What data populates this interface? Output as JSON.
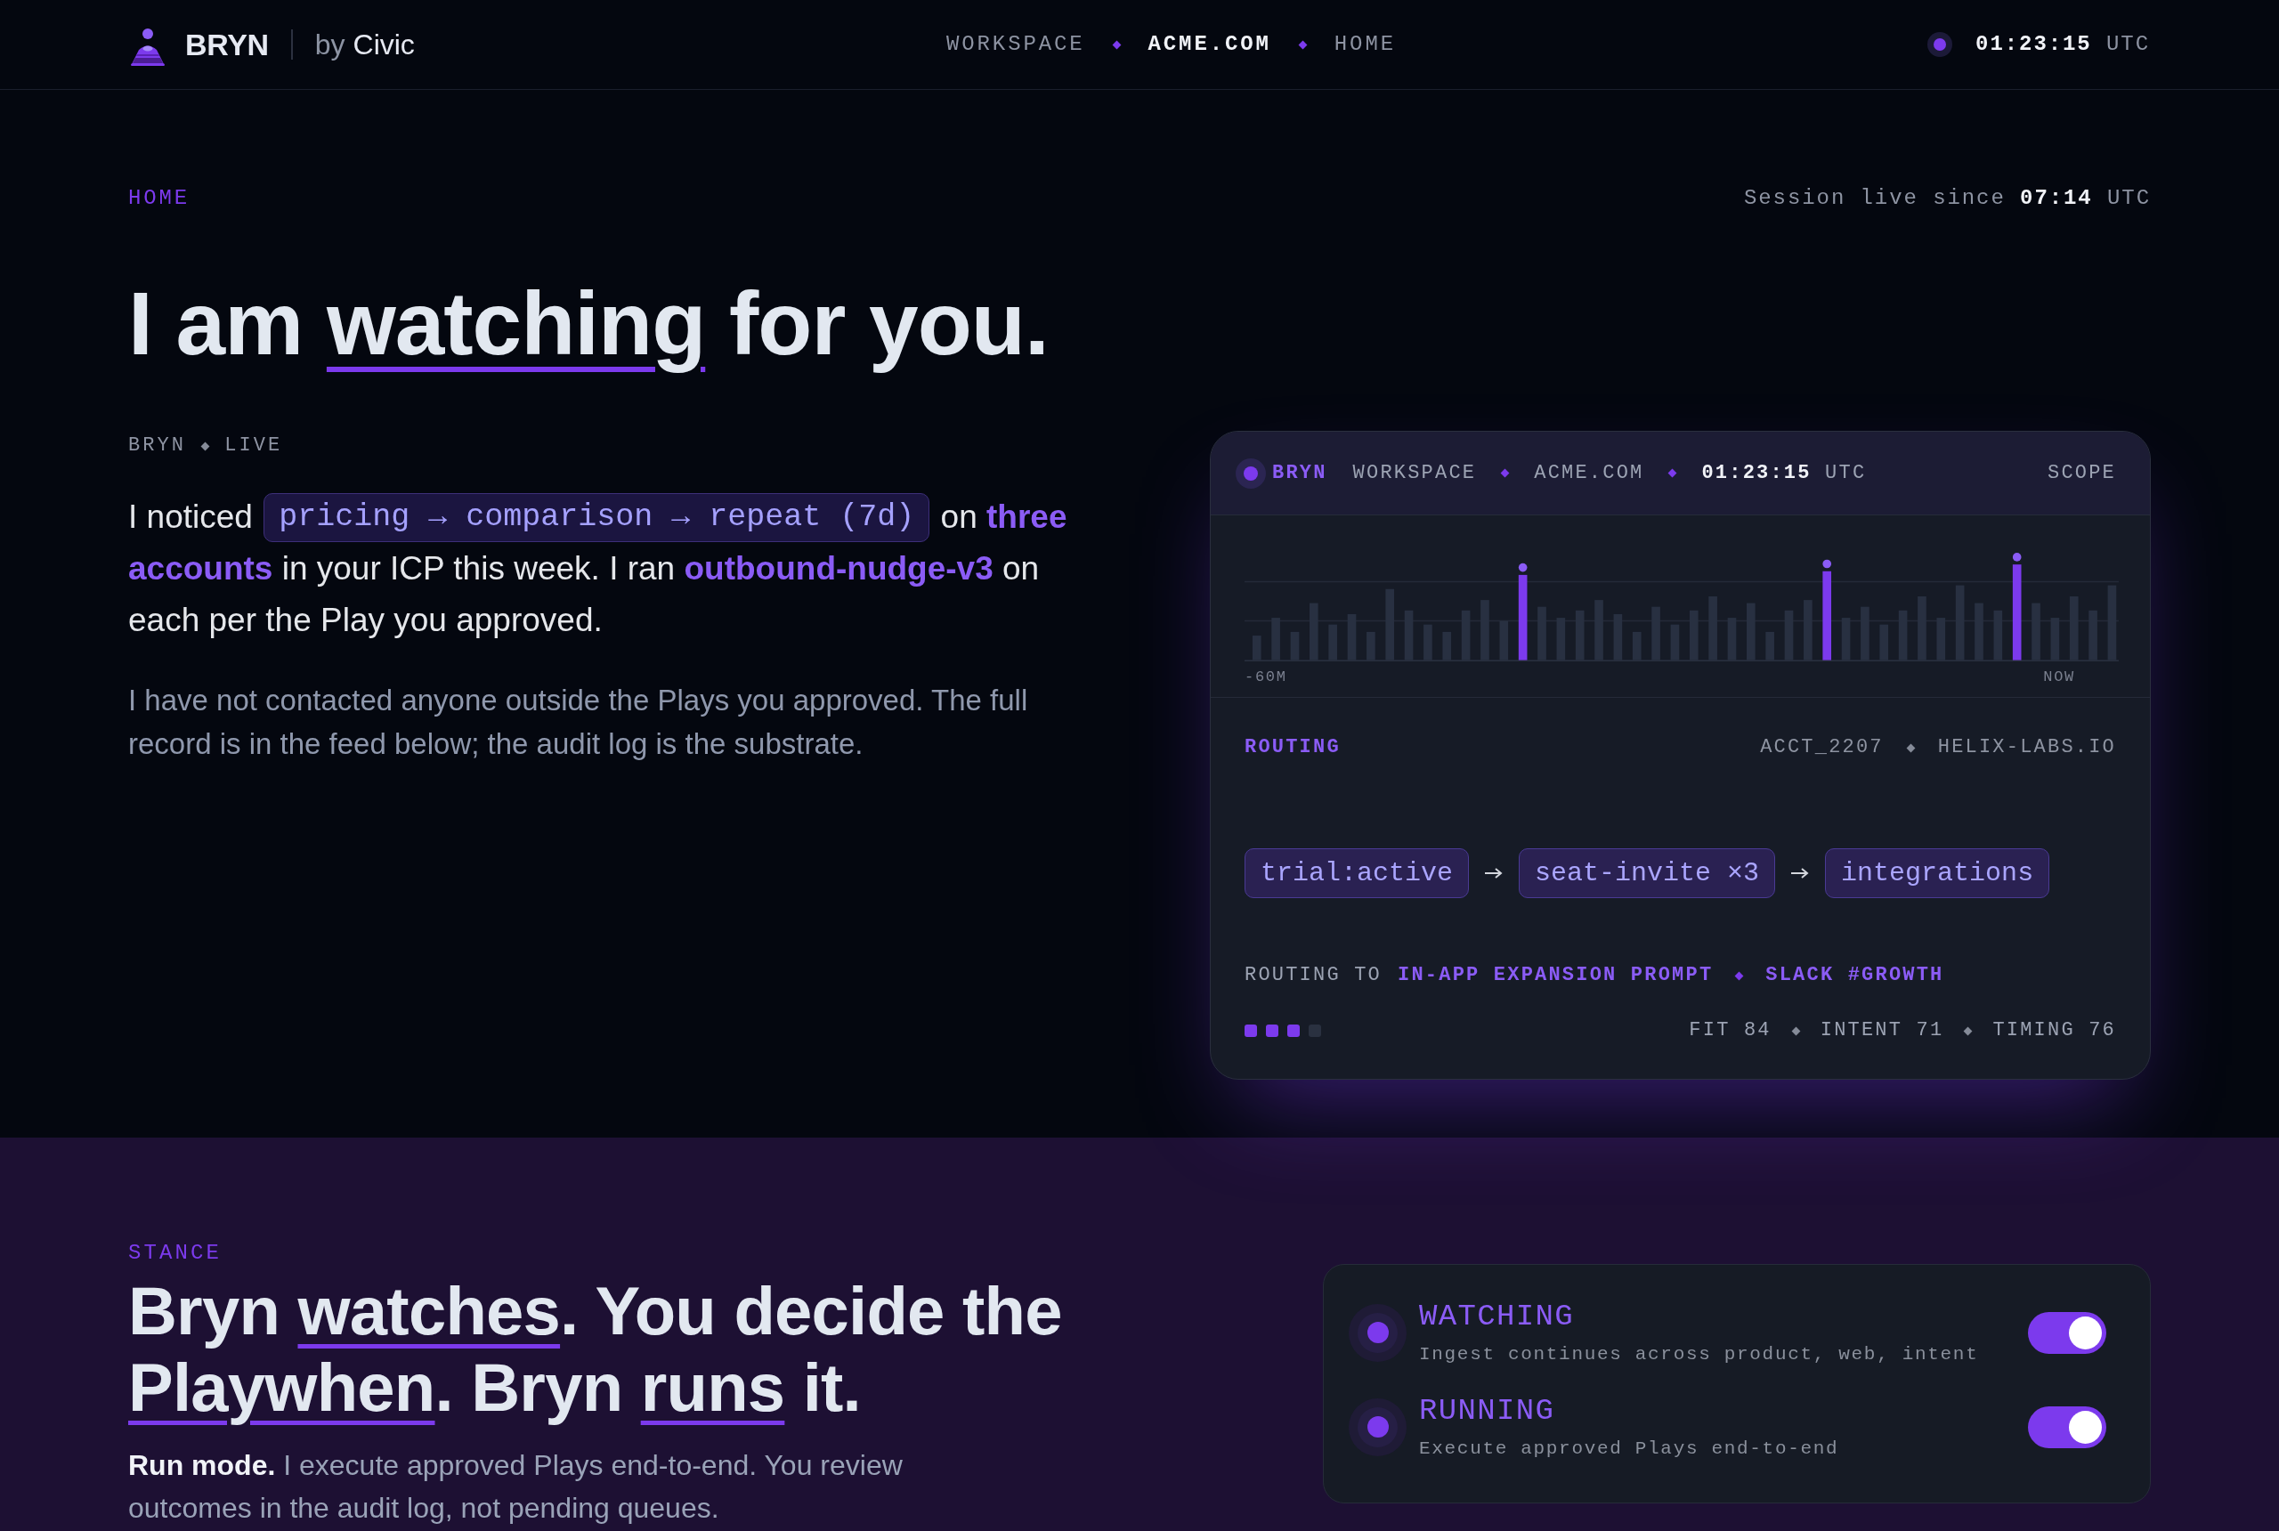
{
  "header": {
    "brand": {
      "name": "BRYN",
      "byline": "by",
      "partner": "Civic"
    },
    "breadcrumb": [
      {
        "label": "WORKSPACE",
        "current": false
      },
      {
        "label": "ACME.COM",
        "current": true
      },
      {
        "label": "HOME",
        "current": false
      }
    ],
    "clock": "**01:23:15** UTC"
  },
  "hero": {
    "eyebrow": "HOME",
    "session": "Session live since **07:14** UTC",
    "headline": [
      {
        "text": "I am ",
        "underlined": false
      },
      {
        "text": "watching",
        "underlined": true
      },
      {
        "text": " for you.",
        "underlined": false
      }
    ],
    "status": [
      "BRYN",
      "LIVE"
    ],
    "summary": [
      {
        "kind": "text",
        "text": "I noticed "
      },
      {
        "kind": "code",
        "text": "pricing → comparison → repeat (7d)"
      },
      {
        "kind": "text",
        "text": " on "
      },
      {
        "kind": "accent",
        "text": "three accounts"
      },
      {
        "kind": "text",
        "text": " in your ICP this week. I ran "
      },
      {
        "kind": "accent",
        "text": "outbound-nudge-v3"
      },
      {
        "kind": "text",
        "text": " on each per the Play you approved."
      }
    ],
    "note": "I have not contacted anyone outside the Plays you approved. The full record is in the feed below; the audit log is the substrate."
  },
  "scope_card": {
    "header": {
      "agent": "BRYN",
      "context": [
        "WORKSPACE",
        "ACME.COM"
      ],
      "clock": "**01:23:15** UTC",
      "action": "SCOPE"
    },
    "activity": {
      "axis_labels": [
        "-60M",
        "NOW"
      ]
    },
    "routing": {
      "title": "ROUTING",
      "account": [
        "ACCT_2207",
        "HELIX-LABS.IO"
      ],
      "path": [
        "trial:active",
        "seat-invite ×3",
        "integrations"
      ],
      "target_label": "ROUTING TO",
      "targets": [
        "IN-APP EXPANSION PROMPT",
        "SLACK #GROWTH"
      ],
      "meter": {
        "level": 0.75
      },
      "scores": [
        "FIT 84",
        "INTENT 71",
        "TIMING 76"
      ]
    }
  },
  "stance": {
    "eyebrow": "STANCE",
    "headline": [
      {
        "text": "Bryn ",
        "underlined": false
      },
      {
        "text": "watches",
        "underlined": true
      },
      {
        "text": ". You decide the ",
        "underlined": false
      },
      {
        "text": "Playwhen",
        "underlined": true
      },
      {
        "text": ". Bryn ",
        "underlined": false
      },
      {
        "text": "runs",
        "underlined": true
      },
      {
        "text": " it.",
        "underlined": false
      }
    ],
    "body": "**Run mode.** I execute approved Plays end-to-end. You review outcomes in the audit log, not pending queues.",
    "modes": [
      {
        "title": "WATCHING",
        "description": "Ingest continues across product, web, intent",
        "on": true
      },
      {
        "title": "RUNNING",
        "description": "Execute approved Plays end-to-end",
        "on": true
      }
    ]
  }
}
